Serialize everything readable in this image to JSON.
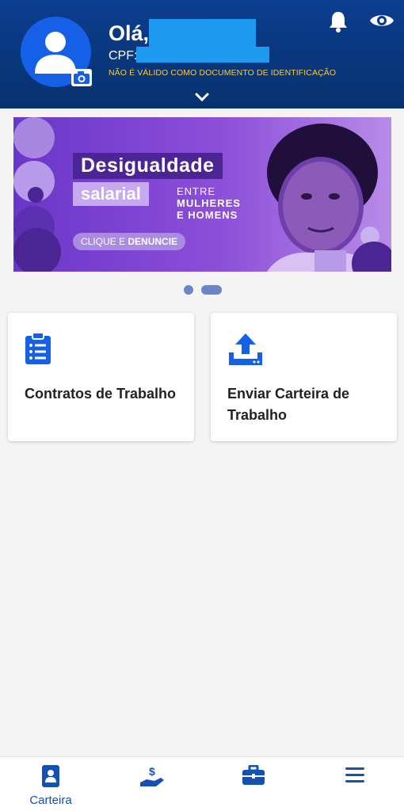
{
  "header": {
    "greeting": "Olá,",
    "cpf_label": "CPF:",
    "warning": "NÃO É VÁLIDO COMO DOCUMENTO DE IDENTIFICAÇÃO"
  },
  "banner": {
    "title_line1": "Desigualdade",
    "title_line2": "salarial",
    "subtitle_line1": "ENTRE",
    "subtitle_line2": "MULHERES",
    "subtitle_line3": "E HOMENS",
    "cta_prefix": "CLIQUE E",
    "cta_strong": "DENUNCIE",
    "active_slide": 2,
    "slide_count": 2
  },
  "cards": [
    {
      "label": "Contratos de Trabalho",
      "icon": "clipboard-list-icon"
    },
    {
      "label": "Enviar Carteira de Trabalho",
      "icon": "upload-icon"
    }
  ],
  "tabbar": {
    "items": [
      {
        "label": "Carteira",
        "icon": "id-card-icon",
        "active": true
      },
      {
        "label": "",
        "icon": "hand-money-icon",
        "active": false
      },
      {
        "label": "",
        "icon": "briefcase-icon",
        "active": false
      },
      {
        "label": "",
        "icon": "menu-icon",
        "active": false
      }
    ]
  },
  "colors": {
    "header_bg": "#0c3d8f",
    "accent": "#1351b4",
    "warning_text": "#f7c948",
    "banner_purple": "#6a36c9"
  }
}
